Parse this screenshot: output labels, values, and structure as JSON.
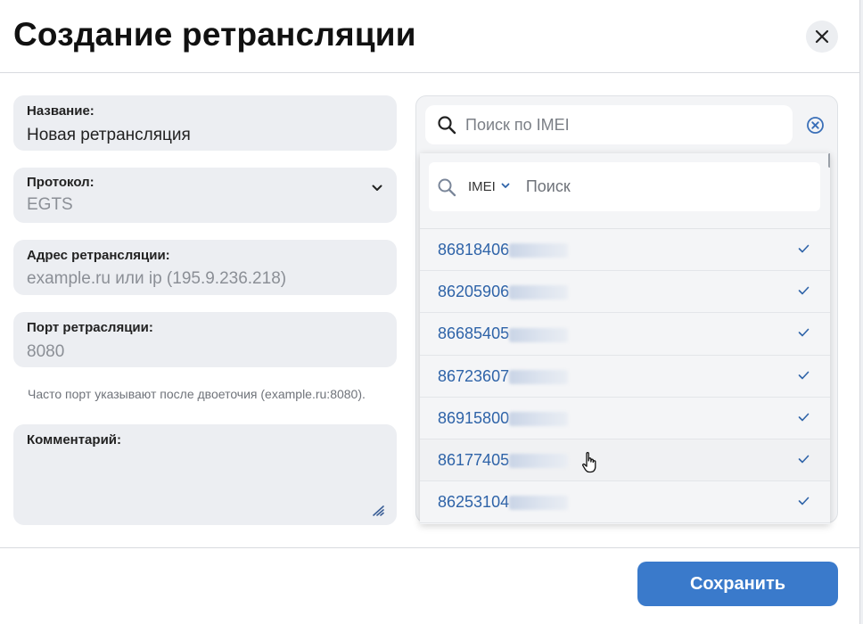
{
  "dialog": {
    "title": "Создание ретрансляции"
  },
  "form": {
    "name": {
      "label": "Название:",
      "value": "Новая ретрансляция"
    },
    "protocol": {
      "label": "Протокол:",
      "value": "EGTS"
    },
    "address": {
      "label": "Адрес ретрансляции:",
      "placeholder": "example.ru или ip (195.9.236.218)"
    },
    "port": {
      "label": "Порт ретрасляции:",
      "placeholder": "8080",
      "hint": "Часто порт указывают после двоеточия (example.ru:8080)."
    },
    "comment": {
      "label": "Комментарий:",
      "value": ""
    }
  },
  "imei_panel": {
    "search_placeholder": "Поиск по IMEI",
    "dropdown": {
      "filter_label": "IMEI",
      "search_placeholder": "Поиск",
      "items": [
        {
          "imei": "86818406",
          "checked": true
        },
        {
          "imei": "86205906",
          "checked": true
        },
        {
          "imei": "86685405",
          "checked": true
        },
        {
          "imei": "86723607",
          "checked": true
        },
        {
          "imei": "86915800",
          "checked": true
        },
        {
          "imei": "86177405",
          "checked": true
        },
        {
          "imei": "86253104",
          "checked": true
        }
      ]
    }
  },
  "footer": {
    "save_label": "Сохранить"
  },
  "colors": {
    "accent": "#3a7acb",
    "link": "#2e63a8",
    "field_bg": "#eceef2"
  }
}
